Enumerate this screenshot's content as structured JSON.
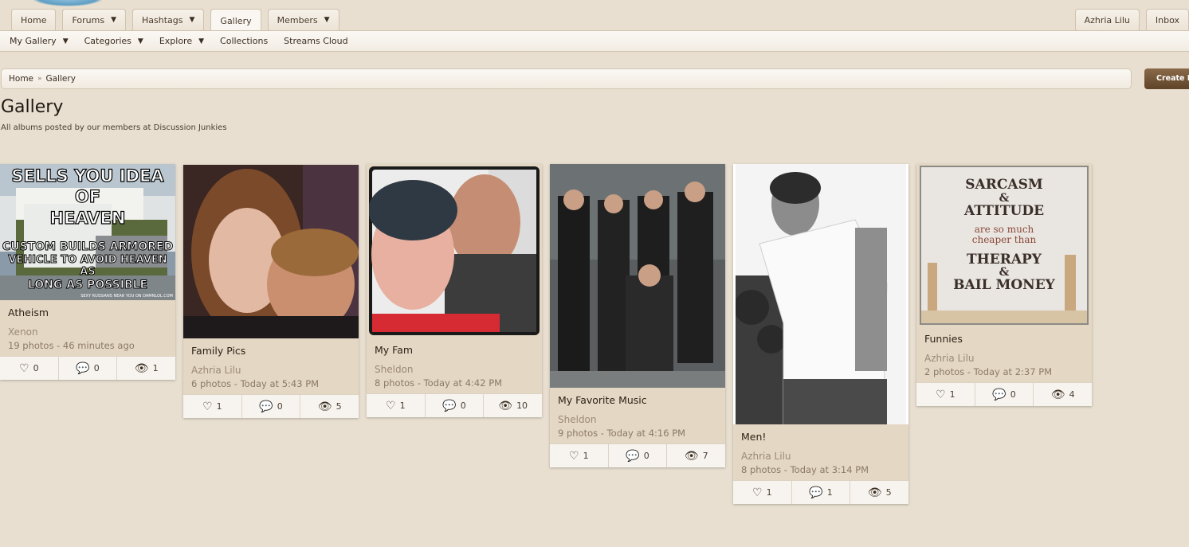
{
  "nav": {
    "tabs": [
      {
        "label": "Home"
      },
      {
        "label": "Forums"
      },
      {
        "label": "Hashtags"
      },
      {
        "label": "Gallery"
      },
      {
        "label": "Members"
      }
    ],
    "right_tabs": [
      {
        "label": "Azhria Lilu"
      },
      {
        "label": "Inbox"
      }
    ],
    "sub_items": [
      {
        "label": "My Gallery"
      },
      {
        "label": "Categories"
      },
      {
        "label": "Explore"
      },
      {
        "label": "Collections"
      },
      {
        "label": "Streams Cloud"
      }
    ]
  },
  "breadcrumb": {
    "home": "Home",
    "separator": "»",
    "current": "Gallery"
  },
  "create_button": "Create New Album",
  "page": {
    "title": "Gallery",
    "description": "All albums posted by our members at Discussion Junkies"
  },
  "albums": [
    {
      "title": "Atheism",
      "owner": "Xenon",
      "sub": "19 photos - 46 minutes ago",
      "likes": "0",
      "comments": "0",
      "views": "1",
      "thumb_text": [
        "SELLS YOU IDEA OF",
        "HEAVEN",
        "CUSTOM BUILDS ARMORED",
        "VEHICLE TO AVOID HEAVEN AS",
        "LONG AS POSSIBLE"
      ],
      "thumb_caption": "SEXY RUSSIANS NEAR YOU ON DAMNLOL.COM"
    },
    {
      "title": "Family Pics",
      "owner": "Azhria Lilu",
      "sub": "6 photos - Today at 5:43 PM",
      "likes": "1",
      "comments": "0",
      "views": "5"
    },
    {
      "title": "My Fam",
      "owner": "Sheldon",
      "sub": "8 photos - Today at 4:42 PM",
      "likes": "1",
      "comments": "0",
      "views": "10"
    },
    {
      "title": "My Favorite Music",
      "owner": "Sheldon",
      "sub": "9 photos - Today at 4:16 PM",
      "likes": "1",
      "comments": "0",
      "views": "7"
    },
    {
      "title": "Men!",
      "owner": "Azhria Lilu",
      "sub": "8 photos - Today at 3:14 PM",
      "likes": "1",
      "comments": "1",
      "views": "5"
    },
    {
      "title": "Funnies",
      "owner": "Azhria Lilu",
      "sub": "2 photos - Today at 2:37 PM",
      "likes": "1",
      "comments": "0",
      "views": "4",
      "thumb_text": [
        "SARCASM",
        "&",
        "ATTITUDE",
        "are so much",
        "cheaper than",
        "THERAPY",
        "&",
        "BAIL MONEY"
      ]
    }
  ],
  "icons": {
    "like": "heart-icon",
    "comment": "comments-icon",
    "view": "eye-icon"
  },
  "colors": {
    "background": "#e8dfd0",
    "card": "#e4d7c3",
    "accent": "#6b4d30"
  }
}
